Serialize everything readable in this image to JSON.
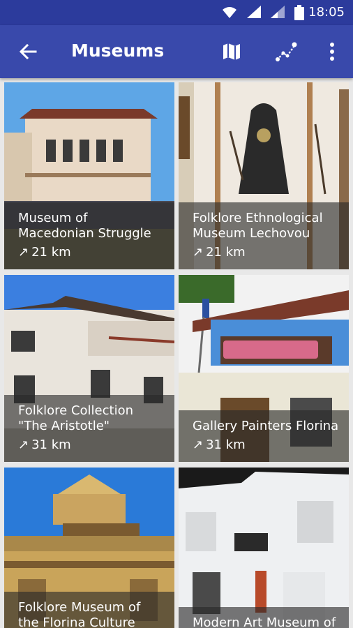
{
  "status_bar": {
    "time": "18:05"
  },
  "toolbar": {
    "title": "Museums"
  },
  "museums": [
    {
      "name": "Museum of Macedonian Struggle",
      "distance": "21 km"
    },
    {
      "name": "Folklore Ethnological Museum Lechovou",
      "distance": "21 km"
    },
    {
      "name": "Folklore Collection \"The Aristotle\"",
      "distance": "31 km"
    },
    {
      "name": "Gallery Painters Florina",
      "distance": "31 km"
    },
    {
      "name": "Folklore Museum of the Florina Culture Club",
      "distance": ""
    },
    {
      "name": "Modern Art Museum of Florina",
      "distance": ""
    }
  ],
  "distance_arrow": "↗",
  "colors": {
    "status_bar": "#2c3b9c",
    "toolbar": "#3949ab"
  },
  "icons": [
    "wifi-icon",
    "cell-signal-icon",
    "battery-icon",
    "back-arrow-icon",
    "map-icon",
    "route-icon",
    "more-vert-icon"
  ]
}
